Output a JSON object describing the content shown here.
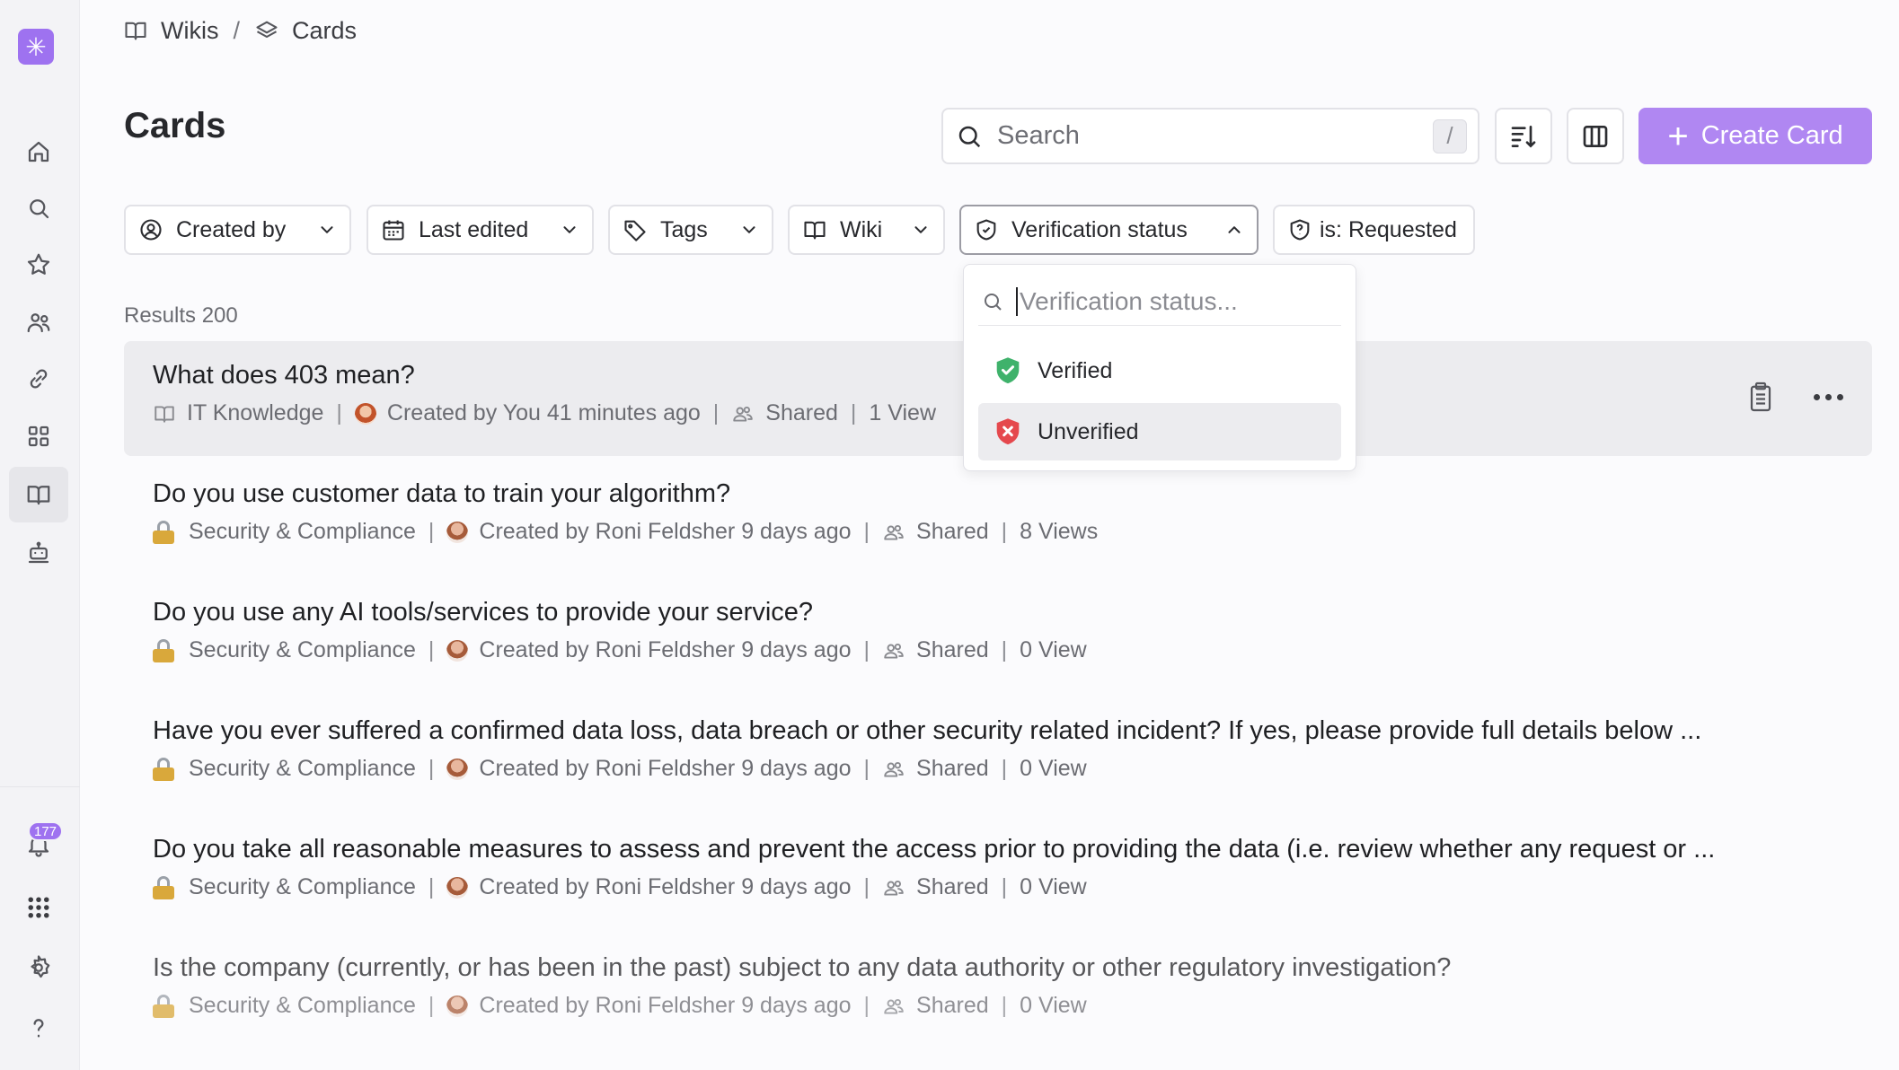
{
  "breadcrumb": {
    "root": "Wikis",
    "separator": "/",
    "current": "Cards"
  },
  "page": {
    "title": "Cards"
  },
  "search": {
    "placeholder": "Search",
    "shortcut": "/"
  },
  "actions": {
    "create_label": "Create Card"
  },
  "sidebar": {
    "notifications_count": "177"
  },
  "filters": [
    {
      "label": "Created by",
      "icon": "user-circle-icon"
    },
    {
      "label": "Last edited",
      "icon": "calendar-icon"
    },
    {
      "label": "Tags",
      "icon": "tag-icon"
    },
    {
      "label": "Wiki",
      "icon": "book-icon"
    },
    {
      "label": "Verification status",
      "icon": "shield-icon",
      "open": true
    },
    {
      "label": "is: Requested",
      "icon": "shield-question-icon"
    }
  ],
  "results": {
    "label": "Results 200"
  },
  "dropdown": {
    "placeholder": "Verification status...",
    "options": [
      {
        "label": "Verified",
        "icon": "shield-check-icon",
        "color": "#3fb26b"
      },
      {
        "label": "Unverified",
        "icon": "shield-x-icon",
        "color": "#e5484d"
      }
    ]
  },
  "cards": [
    {
      "title": "What does 403 mean?",
      "wiki": "IT Knowledge",
      "created": "Created by You 41 minutes ago",
      "shared": "Shared",
      "views": "1 View"
    },
    {
      "title": "Do you use customer data to train your algorithm?",
      "wiki": "Security & Compliance",
      "created": "Created by Roni Feldsher 9 days ago",
      "shared": "Shared",
      "views": "8 Views"
    },
    {
      "title": "Do you use any AI tools/services to provide your service?",
      "wiki": "Security & Compliance",
      "created": "Created by Roni Feldsher 9 days ago",
      "shared": "Shared",
      "views": "0 View"
    },
    {
      "title": "Have you ever suffered a confirmed data loss, data breach or other security related incident? If yes, please provide full details below ...",
      "wiki": "Security & Compliance",
      "created": "Created by Roni Feldsher 9 days ago",
      "shared": "Shared",
      "views": "0 View"
    },
    {
      "title": "Do you take all reasonable measures to assess and prevent the access prior to providing the data (i.e. review whether any request or ...",
      "wiki": "Security & Compliance",
      "created": "Created by Roni Feldsher 9 days ago",
      "shared": "Shared",
      "views": "0 View"
    },
    {
      "title": "Is the company (currently, or has been in the past) subject to any data authority or other regulatory investigation?",
      "wiki": "Security & Compliance",
      "created": "Created by Roni Feldsher 9 days ago",
      "shared": "Shared",
      "views": "0 View"
    }
  ]
}
